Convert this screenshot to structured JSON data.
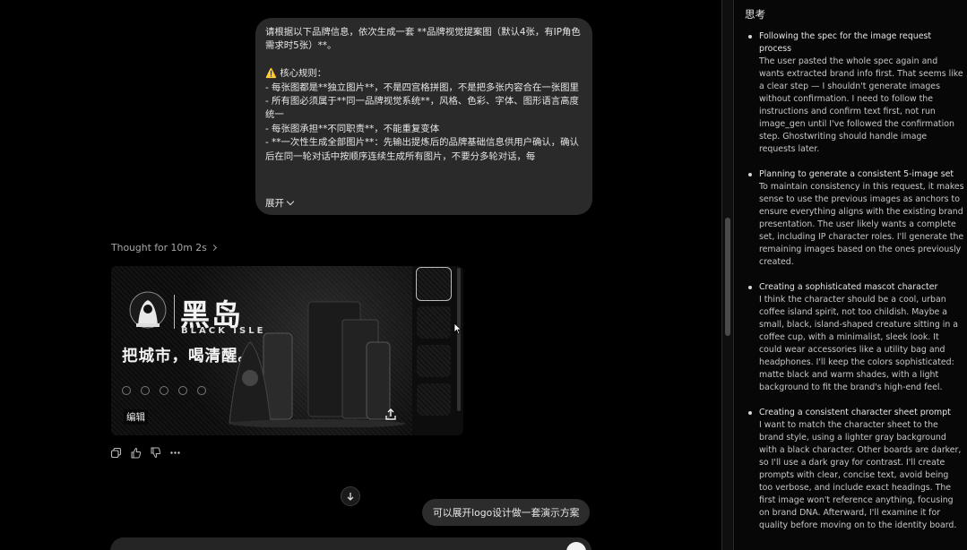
{
  "user_message": {
    "text": "请根据以下品牌信息，依次生成一套 **品牌视觉提案图（默认4张，有IP角色需求时5张）**。\n\n⚠️ 核心规则：\n- 每张图都是**独立图片**，不是四宫格拼图，不是把多张内容合在一张图里\n- 所有图必须属于**同一品牌视觉系统**，风格、色彩、字体、图形语言高度统一\n- 每张图承担**不同职责**，不能重复变体\n- **一次性生成全部图片**：先输出提炼后的品牌基础信息供用户确认，确认后在同一轮对话中按顺序连续生成所有图片，不要分多轮对话，每",
    "expand_label": "展开"
  },
  "thought_label": "Thought for 10m 2s",
  "image_card": {
    "brand_cn": "黑岛",
    "brand_en": "BLACK ISLE",
    "slogan": "把城市，喝清醒。",
    "edit_label": "编辑"
  },
  "suggestion": "可以展开logo设计做一套演示方案",
  "sidebar": {
    "title": "思考",
    "items": [
      {
        "title": "Following the spec for the image request process",
        "body": "The user pasted the whole spec again and wants extracted brand info first. That seems like a clear step — I shouldn't generate images without confirmation. I need to follow the instructions and confirm text first, not run image_gen until I've followed the confirmation step. Ghostwriting should handle image requests later."
      },
      {
        "title": "Planning to generate a consistent 5-image set",
        "body": "To maintain consistency in this request, it makes sense to use the previous images as anchors to ensure everything aligns with the existing brand presentation. The user likely wants a complete set, including IP character roles. I'll generate the remaining images based on the ones previously created."
      },
      {
        "title": "Creating a sophisticated mascot character",
        "body": "I think the character should be a cool, urban coffee island spirit, not too childish. Maybe a small, black, island-shaped creature sitting in a coffee cup, with a minimalist, sleek look. It could wear accessories like a utility bag and headphones. I'll keep the colors sophisticated: matte black and warm shades, with a light background to fit the brand's high-end feel."
      },
      {
        "title": "Creating a consistent character sheet prompt",
        "body": "I want to match the character sheet to the brand style, using a lighter gray background with a black character. Other boards are darker, so I'll use a dark gray for contrast. I'll create prompts with clear, concise text, avoid being too verbose, and include exact headings. The first image won't reference anything, focusing on brand DNA. Afterward, I'll examine it for quality before moving on to the identity board."
      }
    ]
  }
}
